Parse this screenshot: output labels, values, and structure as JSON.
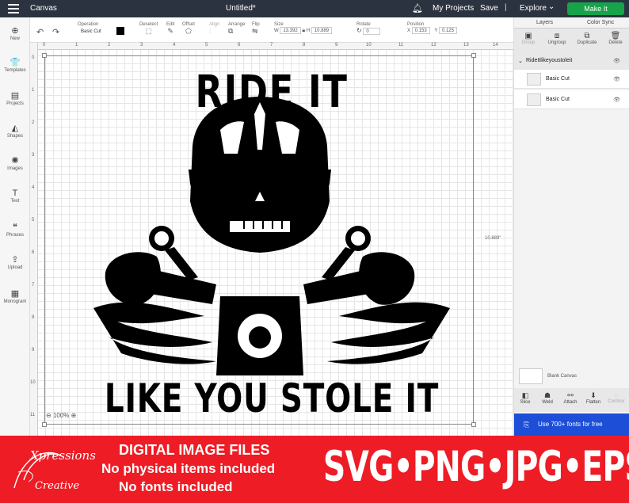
{
  "topbar": {
    "app_name": "Canvas",
    "document_title": "Untitled*",
    "my_projects": "My Projects",
    "save": "Save",
    "separator": "|",
    "explore": "Explore",
    "make_it": "Make It"
  },
  "left_tools": [
    {
      "label": "New",
      "icon": "plus-icon",
      "glyph": "⊕"
    },
    {
      "label": "Templates",
      "icon": "shirt-icon",
      "glyph": "👕"
    },
    {
      "label": "Projects",
      "icon": "clipboard-icon",
      "glyph": "▤"
    },
    {
      "label": "Shapes",
      "icon": "shapes-icon",
      "glyph": "◭"
    },
    {
      "label": "Images",
      "icon": "lightbulb-icon",
      "glyph": "✺"
    },
    {
      "label": "Text",
      "icon": "text-icon",
      "glyph": "T"
    },
    {
      "label": "Phrases",
      "icon": "speech-bubble-icon",
      "glyph": "❝"
    },
    {
      "label": "Upload",
      "icon": "upload-icon",
      "glyph": "⇪"
    },
    {
      "label": "Monogram",
      "icon": "monogram-icon",
      "glyph": "▦"
    }
  ],
  "edit_toolbar": {
    "operation_label": "Operation",
    "operation_value": "Basic Cut",
    "deselect": "Deselect",
    "edit": "Edit",
    "offset": "Offset",
    "align": "Align",
    "arrange": "Arrange",
    "flip": "Flip",
    "size_label": "Size",
    "w_label": "W",
    "w_value": "13.392",
    "h_label": "H",
    "h_value": "10.889",
    "rotate_label": "Rotate",
    "rotate_value": "0",
    "position_label": "Position",
    "x_label": "X",
    "x_value": "0.153",
    "y_label": "Y",
    "y_value": "0.125",
    "line_color": "#000000"
  },
  "rulers": {
    "top": [
      "0",
      "1",
      "2",
      "3",
      "4",
      "5",
      "6",
      "7",
      "8",
      "9",
      "10",
      "11",
      "12",
      "13",
      "14"
    ],
    "left": [
      "0",
      "1",
      "2",
      "3",
      "4",
      "5",
      "6",
      "7",
      "8",
      "9",
      "10",
      "11"
    ]
  },
  "canvas": {
    "height_dimension": "10.889\"",
    "zoom": "100%",
    "design_line1": "RIDE IT",
    "design_line2": "LIKE YOU STOLE IT"
  },
  "right_panel": {
    "tab_layers": "Layers",
    "tab_color_sync": "Color Sync",
    "actions": [
      "Group",
      "Ungroup",
      "Duplicate",
      "Delete"
    ],
    "group_name": "RideItlikeyoustoleit",
    "layers": [
      "Basic Cut",
      "Basic Cut"
    ],
    "blank_canvas": "Blank Canvas",
    "bottom_actions": [
      "Slice",
      "Weld",
      "Attach",
      "Flatten",
      "Contour"
    ],
    "fonts_banner": "Use 700+ fonts for free"
  },
  "banner": {
    "logo_line1": "Xpressions",
    "logo_line2": "Creative",
    "line1": "DIGITAL IMAGE FILES",
    "line2": "No physical items included",
    "line3": "No fonts included",
    "formats": "SVG•PNG•JPG•EPS"
  }
}
